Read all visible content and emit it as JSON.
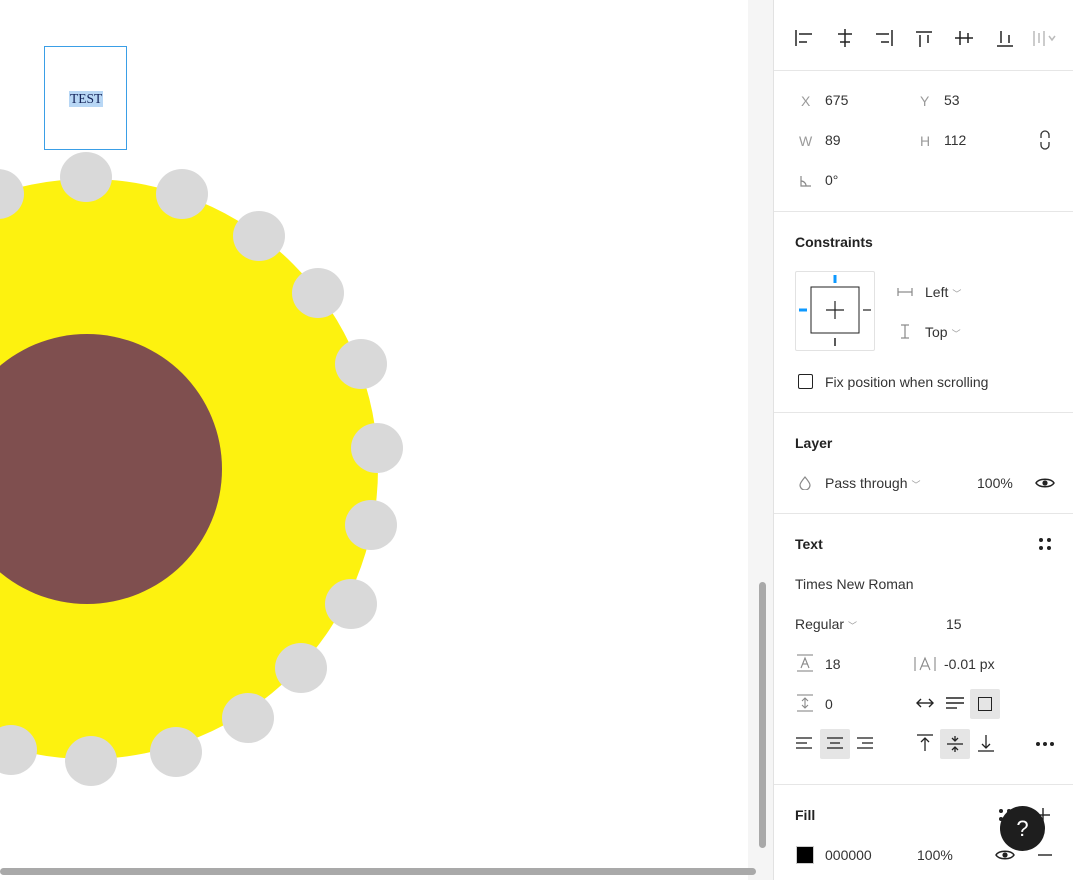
{
  "canvas": {
    "selected_text": "TEST"
  },
  "position": {
    "x_label": "X",
    "x_value": "675",
    "y_label": "Y",
    "y_value": "53",
    "w_label": "W",
    "w_value": "89",
    "h_label": "H",
    "h_value": "112",
    "rotation": "0°"
  },
  "constraints": {
    "title": "Constraints",
    "horizontal": "Left",
    "vertical": "Top",
    "fix_position_label": "Fix position when scrolling"
  },
  "layer": {
    "title": "Layer",
    "blend_mode": "Pass through",
    "opacity": "100%"
  },
  "text": {
    "title": "Text",
    "font_family": "Times New Roman",
    "font_weight": "Regular",
    "font_size": "15",
    "line_height": "18",
    "letter_spacing": "-0.01 px",
    "paragraph_spacing": "0"
  },
  "fill": {
    "title": "Fill",
    "hex": "000000",
    "opacity": "100%",
    "swatch_color": "#000000"
  },
  "help": {
    "label": "?"
  },
  "colors": {
    "petal_center": "#FDF20F",
    "disc": "#7F4F4F",
    "seed": "#D9D9D9",
    "selection": "#3A9EE6",
    "accent": "#0D99FF"
  }
}
